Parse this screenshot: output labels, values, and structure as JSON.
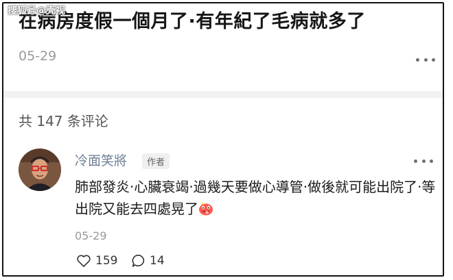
{
  "watermark": "搜狐号@壳视",
  "post": {
    "title": "在病房度假一個月了·有年紀了毛病就多了",
    "date": "05-29"
  },
  "comments": {
    "count_label": "共 147 条评论",
    "items": [
      {
        "author": "冷面笑將",
        "badge": "作者",
        "text": "肺部發炎·心臟衰竭·過幾天要做心導管·做後就可能出院了·等出院又能去四處晃了",
        "emoji_icon": "tongue-out-emoji-icon",
        "date": "05-29",
        "likes": "159",
        "replies": "14"
      }
    ]
  }
}
